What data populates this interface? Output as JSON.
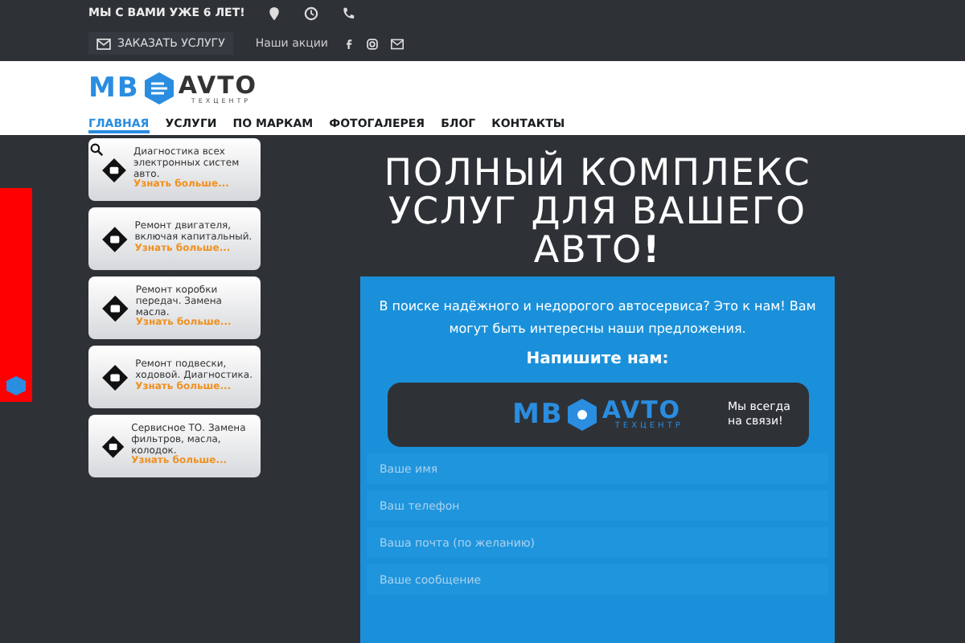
{
  "top_bar": {
    "tagline": "МЫ С ВАМИ УЖЕ 6 ЛЕТ!",
    "order_button": "ЗАКАЗАТЬ УСЛУГУ",
    "promo_link": "Наши акции"
  },
  "logo": {
    "left": "MB",
    "right": "AVTO",
    "subtitle": "ТЕХЦЕНТР"
  },
  "nav": [
    {
      "label": "ГЛАВНАЯ",
      "selected": true
    },
    {
      "label": "УСЛУГИ",
      "selected": false
    },
    {
      "label": "ПО МАРКАМ",
      "selected": false
    },
    {
      "label": "ФОТОГАЛЕРЕЯ",
      "selected": false
    },
    {
      "label": "БЛОГ",
      "selected": false
    },
    {
      "label": "КОНТАКТЫ",
      "selected": false
    }
  ],
  "services": [
    {
      "text": "Диагностика всех электронных систем авто.",
      "link": "Узнать больше..."
    },
    {
      "text": "Ремонт двигателя, включая капитальный.",
      "link": "Узнать больше..."
    },
    {
      "text": "Ремонт коробки передач. Замена масла.",
      "link": "Узнать больше..."
    },
    {
      "text": "Ремонт подвески, ходовой. Диагностика.",
      "link": "Узнать больше..."
    },
    {
      "text": "Сервисное ТО. Замена фильтров, масла, колодок.",
      "link": "Узнать больше..."
    }
  ],
  "hero": {
    "title": "ПОЛНЫЙ КОМПЛЕКС УСЛУГ ДЛЯ ВАШЕГО АВТО**!**"
  },
  "contact_panel": {
    "intro": "В поиске надёжного и недорогого автосервиса? Это к нам! Вам могут быть интересны наши предложения.",
    "heading": "Напишите нам:",
    "banner_logo": {
      "left": "MB",
      "right": "AVTO",
      "subtitle": "ТЕХЦЕНТР"
    },
    "banner_text": "Мы всегда на связи!",
    "fields": [
      {
        "placeholder": "Ваше имя"
      },
      {
        "placeholder": "Ваш телефон"
      },
      {
        "placeholder": "Ваша почта (по желанию)"
      },
      {
        "placeholder": "Ваше сообщение"
      }
    ]
  }
}
